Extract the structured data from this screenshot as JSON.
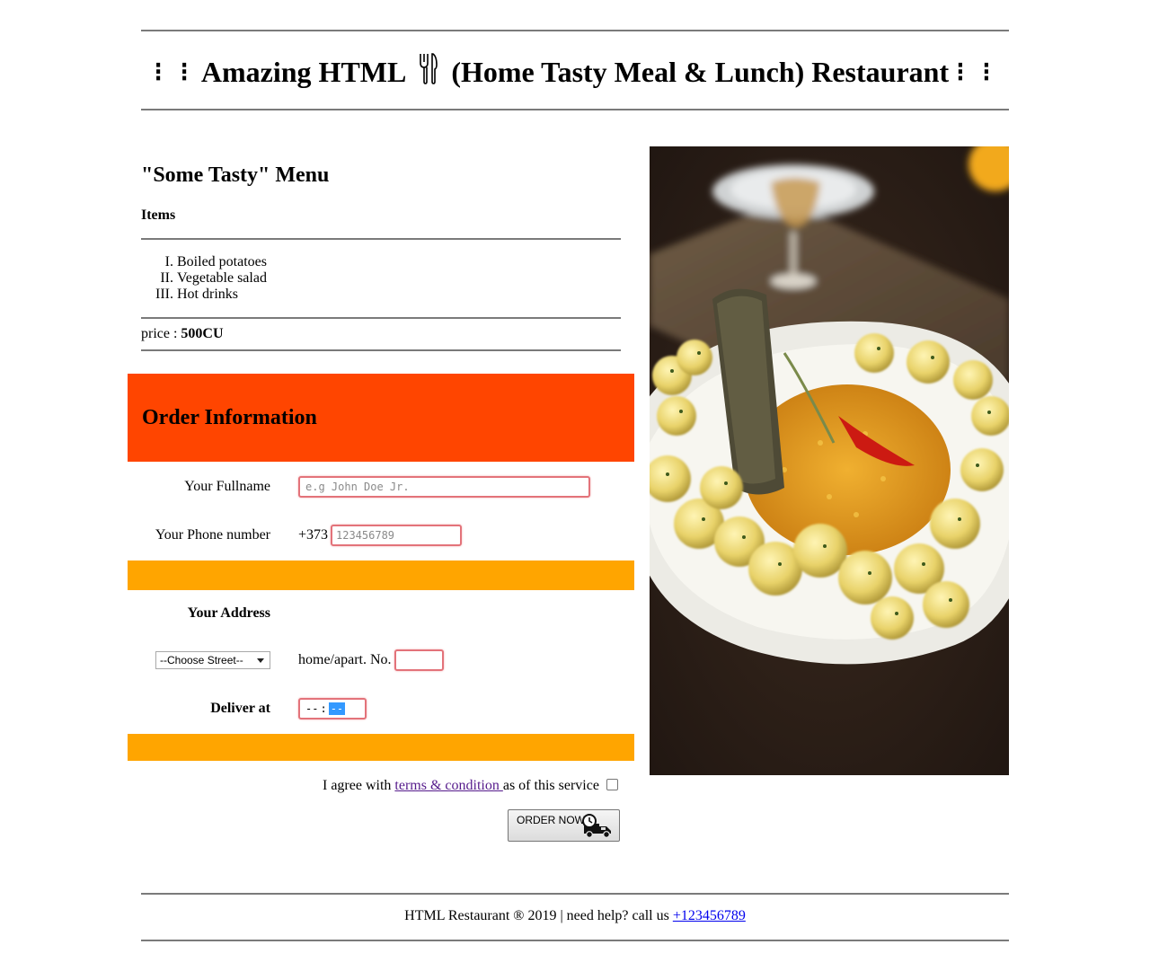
{
  "header": {
    "title_left_ornament": "⁝ ⁝",
    "title_part1": "Amazing HTML",
    "title_icon": "fork-and-knife-icon",
    "title_part2": "(Home Tasty Meal & Lunch) Restaurant",
    "title_right_ornament": "⁝ ⁝"
  },
  "menu": {
    "title": "\"Some Tasty\" Menu",
    "items_label": "Items",
    "items": [
      {
        "num": "I.",
        "label": "Boiled potatoes"
      },
      {
        "num": "II.",
        "label": "Vegetable salad"
      },
      {
        "num": "III.",
        "label": "Hot drinks"
      }
    ],
    "price_label": "price : ",
    "price_value": "500CU"
  },
  "order": {
    "title": "Order Information",
    "fullname_label": "Your Fullname",
    "fullname_placeholder": "e.g John Doe Jr.",
    "phone_label": "Your Phone number",
    "phone_prefix": "+373",
    "phone_placeholder": "123456789",
    "address_label": "Your Address",
    "street_select": "--Choose Street--",
    "home_label": "home/apart. No.",
    "deliver_label": "Deliver at",
    "time_hours": "--",
    "time_sep": ":",
    "time_minutes": "--",
    "agree_prefix": "I agree with ",
    "agree_link": "terms & condition ",
    "agree_suffix": "as of this service",
    "order_button": "ORDER NOW",
    "order_button_icon": "delivery-truck-clock-icon"
  },
  "footer": {
    "text": "HTML Restaurant ® 2019 | need help? call us ",
    "phone_link": "+123456789"
  },
  "colors": {
    "order_header": "#ff4500",
    "band": "#ffa500",
    "input_border": "#e3737a"
  }
}
